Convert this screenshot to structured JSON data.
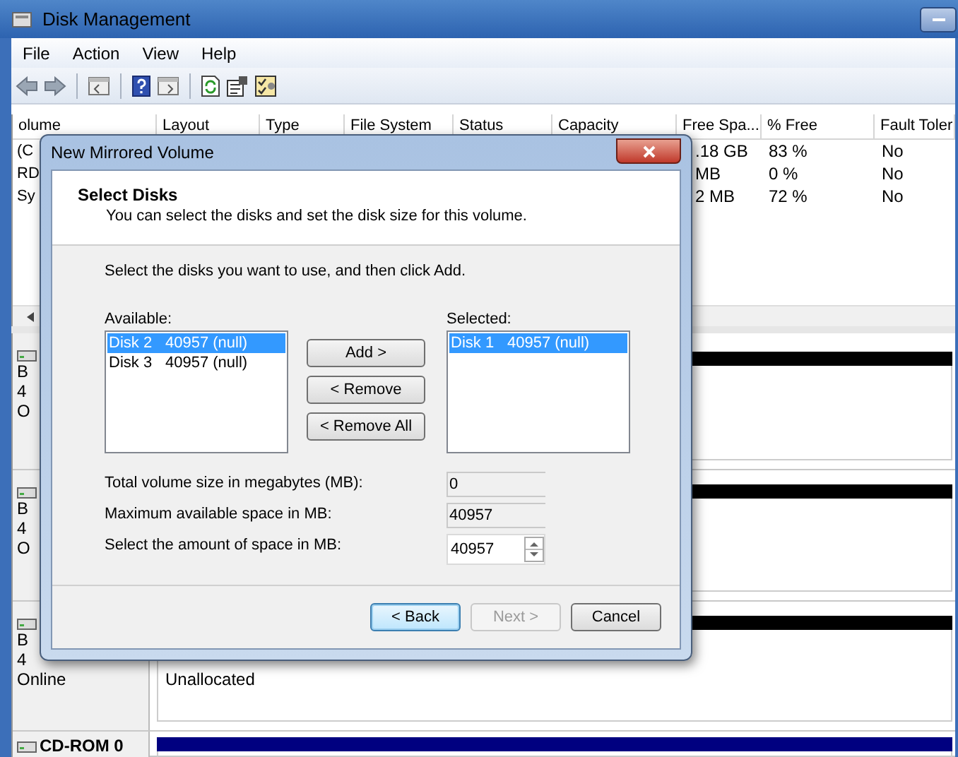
{
  "window": {
    "title": "Disk Management"
  },
  "menu": [
    "File",
    "Action",
    "View",
    "Help"
  ],
  "volume_table": {
    "columns": [
      "olume",
      "Layout",
      "Type",
      "File System",
      "Status",
      "Capacity",
      "Free Spa...",
      "% Free",
      "Fault Toler"
    ],
    "rows": [
      {
        "volume": "(C",
        "free_space": ".18 GB",
        "percent_free": "83 %",
        "fault_tolerance": "No"
      },
      {
        "volume": "RD",
        "free_space": "MB",
        "percent_free": "0 %",
        "fault_tolerance": "No"
      },
      {
        "volume": "Sy",
        "free_space": "2 MB",
        "percent_free": "72 %",
        "fault_tolerance": "No"
      }
    ]
  },
  "disks": [
    {
      "lines": [
        "B",
        "4",
        "O"
      ],
      "color": "#000000"
    },
    {
      "lines": [
        "B",
        "4",
        "O"
      ],
      "color": "#000000"
    },
    {
      "lines": [
        "B",
        "4",
        "Online"
      ],
      "partition": "Unallocated",
      "color": "#000000"
    },
    {
      "lines": [
        "CD-ROM 0"
      ],
      "color": "#000080"
    }
  ],
  "dialog": {
    "title": "New Mirrored Volume",
    "heading": "Select Disks",
    "subheading": "You can select the disks and set the disk size for this volume.",
    "instruction": "Select the disks you want to use, and then click Add.",
    "available_label": "Available:",
    "available": [
      {
        "disk": "Disk 2",
        "size": "40957 (null)",
        "selected": true
      },
      {
        "disk": "Disk 3",
        "size": "40957 (null)",
        "selected": false
      }
    ],
    "move_buttons": [
      "Add >",
      "< Remove",
      "< Remove All"
    ],
    "selected_label": "Selected:",
    "selected_disks": [
      {
        "disk": "Disk 1",
        "size": "40957 (null)",
        "selected": true
      }
    ],
    "fields": [
      {
        "label": "Total volume size in megabytes (MB):",
        "value": "0",
        "kind": "readonly"
      },
      {
        "label": "Maximum available space in MB:",
        "value": "40957",
        "kind": "readonly"
      },
      {
        "label": "Select the amount of space in MB:",
        "value": "40957",
        "kind": "spinner"
      }
    ],
    "buttons": [
      {
        "label": "< Back",
        "default": true,
        "disabled": false
      },
      {
        "label": "Next >",
        "default": false,
        "disabled": true
      },
      {
        "label": "Cancel",
        "default": false,
        "disabled": false
      }
    ]
  }
}
